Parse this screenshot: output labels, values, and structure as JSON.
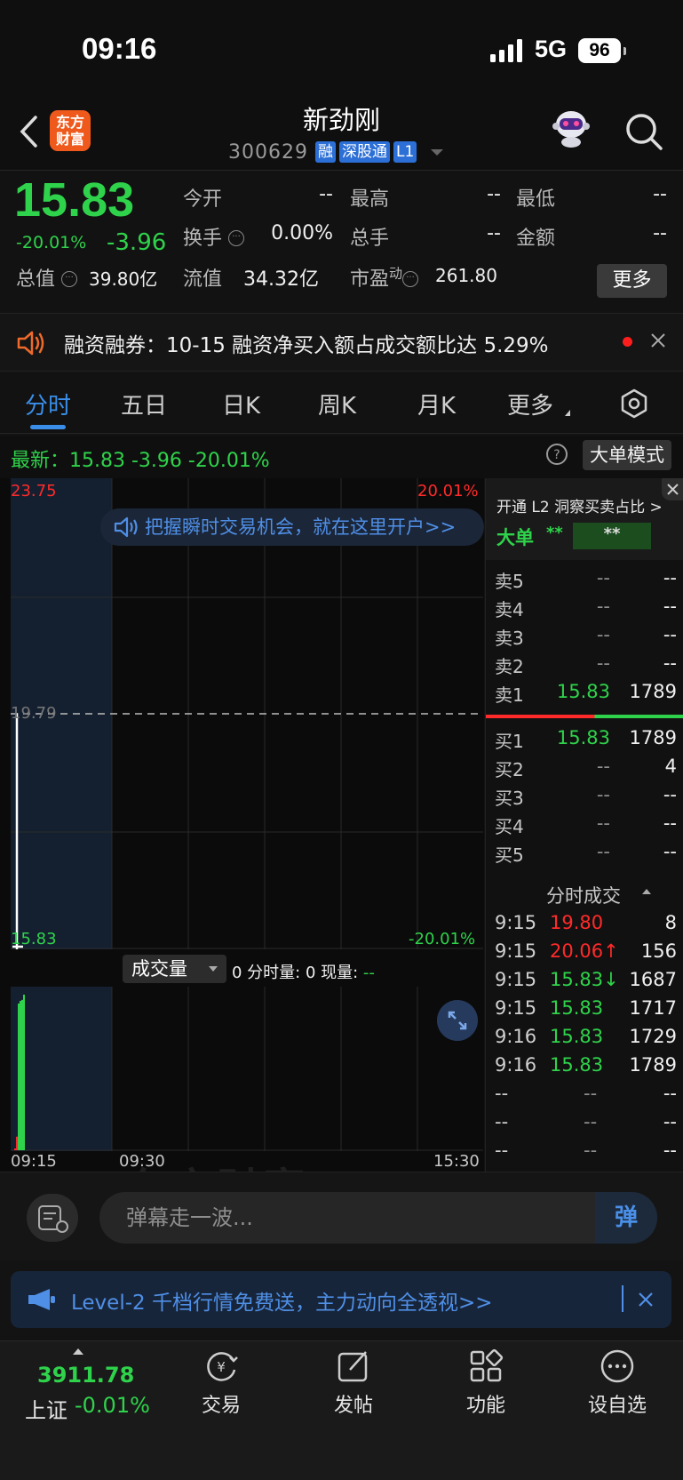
{
  "status": {
    "time": "09:16",
    "network": "5G",
    "battery": "96"
  },
  "header": {
    "logo_line1": "东方",
    "logo_line2": "财富",
    "stock_name": "新劲刚",
    "stock_code": "300629",
    "tags": [
      "融",
      "深股通",
      "L1"
    ]
  },
  "quote": {
    "price": "15.83",
    "change_pct": "-20.01%",
    "change": "-3.96",
    "fields": {
      "open_label": "今开",
      "open": "--",
      "high_label": "最高",
      "high": "--",
      "low_label": "最低",
      "low": "--",
      "turnover_label": "换手",
      "turnover": "0.00%",
      "volume_label": "总手",
      "volume": "--",
      "amount_label": "金额",
      "amount": "--",
      "mktcap_label": "总值",
      "mktcap": "39.80亿",
      "float_label": "流值",
      "float_cap": "34.32亿",
      "pe_label": "市盈",
      "pe_sup": "动",
      "pe": "261.80"
    },
    "more_button": "更多"
  },
  "margin_banner": {
    "text": "融资融券：10-15 融资净买入额占成交额比达 5.29%"
  },
  "tabs": [
    "分时",
    "五日",
    "日K",
    "周K",
    "月K",
    "更多"
  ],
  "latest": {
    "text": "最新：15.83  -3.96  -20.01%",
    "mode_button": "大单模式"
  },
  "chart": {
    "promo": "把握瞬时交易机会，就在这里开户>>",
    "watermark": "东方财富",
    "top_price": "23.75",
    "top_pct": "20.01%",
    "mid_price": "19.79",
    "bottom_price": "15.83",
    "bottom_pct": "-20.01%",
    "volume_select": "成交量",
    "volume_info": "0 分时量: 0 现量: ",
    "volume_now": "--",
    "time_start": "09:15",
    "time_mid": "09:30",
    "time_end": "15:30"
  },
  "chart_data": {
    "type": "line",
    "price_range": [
      15.83,
      23.75
    ],
    "prev_close": 19.79,
    "x": [
      "09:15",
      "09:16"
    ],
    "price_series": [
      19.8,
      15.83
    ],
    "volume_bars": [
      8,
      156,
      1687,
      1717,
      1729,
      1789
    ]
  },
  "order_book": {
    "l2_open": "开通 L2 洞察买卖占比 >",
    "big_label": "大单",
    "big_val1": "**",
    "big_val2": "**",
    "sells": [
      {
        "label": "卖5",
        "price": "--",
        "vol": "--"
      },
      {
        "label": "卖4",
        "price": "--",
        "vol": "--"
      },
      {
        "label": "卖3",
        "price": "--",
        "vol": "--"
      },
      {
        "label": "卖2",
        "price": "--",
        "vol": "--"
      },
      {
        "label": "卖1",
        "price": "15.83",
        "vol": "1789"
      }
    ],
    "buys": [
      {
        "label": "买1",
        "price": "15.83",
        "vol": "1789"
      },
      {
        "label": "买2",
        "price": "--",
        "vol": "4"
      },
      {
        "label": "买3",
        "price": "--",
        "vol": "--"
      },
      {
        "label": "买4",
        "price": "--",
        "vol": "--"
      },
      {
        "label": "买5",
        "price": "--",
        "vol": "--"
      }
    ],
    "ticks_title": "分时成交",
    "ticks": [
      {
        "time": "9:15",
        "price": "19.80",
        "vol": "8"
      },
      {
        "time": "9:15",
        "price": "20.06↑",
        "vol": "156"
      },
      {
        "time": "9:15",
        "price": "15.83↓",
        "vol": "1687"
      },
      {
        "time": "9:15",
        "price": "15.83",
        "vol": "1717"
      },
      {
        "time": "9:16",
        "price": "15.83",
        "vol": "1729"
      },
      {
        "time": "9:16",
        "price": "15.83",
        "vol": "1789"
      },
      {
        "time": "--",
        "price": "--",
        "vol": "--"
      },
      {
        "time": "--",
        "price": "--",
        "vol": "--"
      },
      {
        "time": "--",
        "price": "--",
        "vol": "--"
      }
    ]
  },
  "danmaku": {
    "placeholder": "弹幕走一波...",
    "send": "弹"
  },
  "level2_banner": {
    "text": "Level-2 千档行情免费送，主力动向全透视>>"
  },
  "bottom_nav": {
    "index_value": "3911.78",
    "index_name": "上证",
    "index_change": "-0.01%",
    "items": [
      "交易",
      "发帖",
      "功能",
      "设自选"
    ]
  },
  "colors": {
    "up": "#ff2a2a",
    "down": "#2fd34b",
    "accent": "#3a8ee8"
  }
}
